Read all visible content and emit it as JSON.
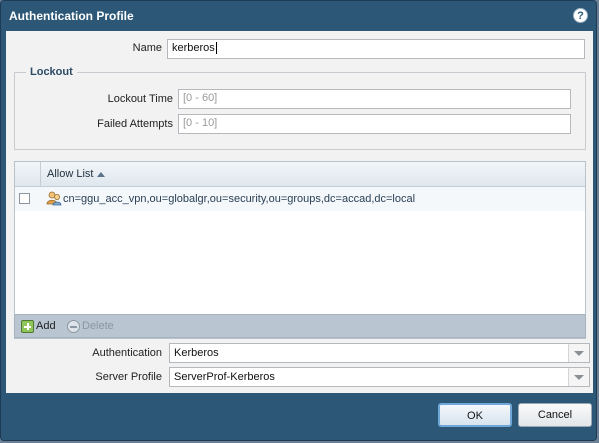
{
  "dialog": {
    "title": "Authentication Profile"
  },
  "form": {
    "name_label": "Name",
    "name_value": "kerberos",
    "lockout_legend": "Lockout",
    "lockout_time_label": "Lockout Time",
    "lockout_time_placeholder": "[0 - 60]",
    "failed_attempts_label": "Failed Attempts",
    "failed_attempts_placeholder": "[0 - 10]"
  },
  "allow_list": {
    "column_header": "Allow List",
    "rows": [
      {
        "value": "cn=ggu_acc_vpn,ou=globalgr,ou=security,ou=groups,dc=accad,dc=local",
        "checked": false
      }
    ],
    "add_label": "Add",
    "delete_label": "Delete"
  },
  "auth": {
    "authentication_label": "Authentication",
    "authentication_value": "Kerberos",
    "server_profile_label": "Server Profile",
    "server_profile_value": "ServerProf-Kerberos"
  },
  "buttons": {
    "ok": "OK",
    "cancel": "Cancel"
  },
  "colors": {
    "frame": "#2c5777",
    "body": "#f2f2f2",
    "toolbar": "#b9c6d1"
  }
}
